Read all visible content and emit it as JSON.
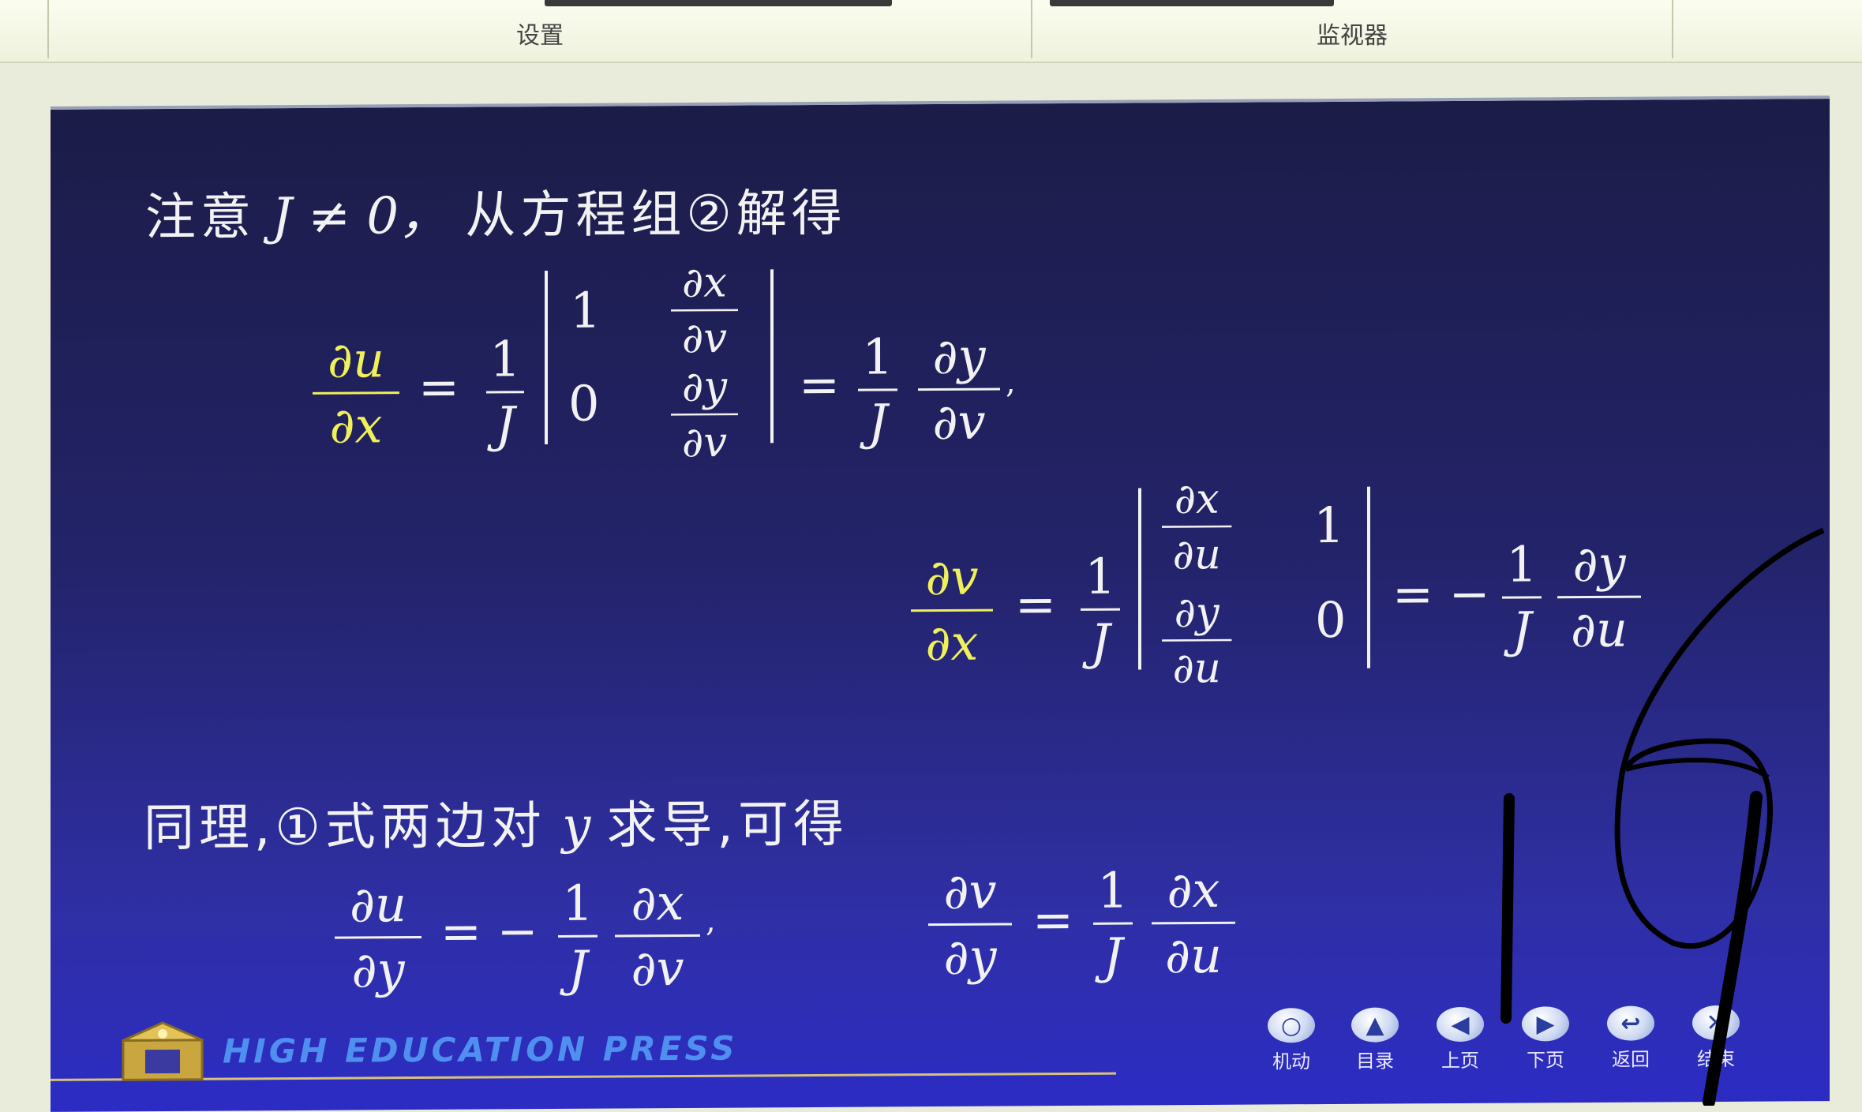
{
  "ribbon": {
    "groups": [
      "设置",
      "监视器"
    ]
  },
  "slide": {
    "line1": {
      "text_cn": "注意",
      "expr": "J ≠ 0，",
      "text_cn2": "从方程组②解得"
    },
    "eq1": {
      "lhs_num": "∂u",
      "lhs_den": "∂x",
      "eq": "=",
      "coef_num": "1",
      "coef_den": "J",
      "m11": "1",
      "m12_num": "∂x",
      "m12_den": "∂v",
      "m21": "0",
      "m22_num": "∂y",
      "m22_den": "∂v",
      "eq2": "=",
      "r1_num": "1",
      "r1_den": "J",
      "r2_num": "∂y",
      "r2_den": "∂v",
      "tail": ","
    },
    "eq2": {
      "lhs_num": "∂v",
      "lhs_den": "∂x",
      "eq": "=",
      "coef_num": "1",
      "coef_den": "J",
      "m11_num": "∂x",
      "m11_den": "∂u",
      "m12": "1",
      "m21_num": "∂y",
      "m21_den": "∂u",
      "m22": "0",
      "eq2": "= −",
      "r1_num": "1",
      "r1_den": "J",
      "r2_num": "∂y",
      "r2_den": "∂u"
    },
    "line3": {
      "text_cn": "同理,①式两边对",
      "var": "y",
      "text_cn2": "求导,可得"
    },
    "eq3": {
      "lhs_num": "∂u",
      "lhs_den": "∂y",
      "eq": "= −",
      "r1_num": "1",
      "r1_den": "J",
      "r2_num": "∂x",
      "r2_den": "∂v",
      "tail": ","
    },
    "eq4": {
      "lhs_num": "∂v",
      "lhs_den": "∂y",
      "eq": "=",
      "r1_num": "1",
      "r1_den": "J",
      "r2_num": "∂x",
      "r2_den": "∂u"
    },
    "footer": {
      "press": "HIGH EDUCATION PRESS",
      "nav": [
        {
          "label": "机动",
          "icon": "circle-icon"
        },
        {
          "label": "目录",
          "icon": "up-arrow-icon"
        },
        {
          "label": "上页",
          "icon": "left-arrow-icon"
        },
        {
          "label": "下页",
          "icon": "right-arrow-icon"
        },
        {
          "label": "返回",
          "icon": "return-icon"
        },
        {
          "label": "结束",
          "icon": "close-icon"
        }
      ]
    }
  },
  "colors": {
    "slide_bg_top": "#1c1c48",
    "slide_bg_bottom": "#2c2cc4",
    "highlight": "#f0f05a",
    "press_text": "#4f8ff0"
  }
}
